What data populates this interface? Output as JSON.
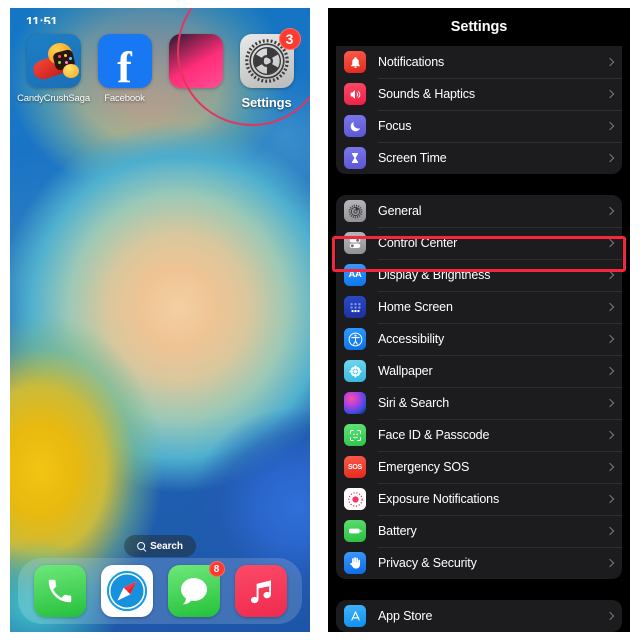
{
  "home": {
    "status_time": "11:51",
    "apps": [
      {
        "label": "CandyCrushSaga",
        "icon": "candy-crush-icon",
        "badge": null
      },
      {
        "label": "Facebook",
        "icon": "facebook-icon",
        "badge": null
      },
      {
        "label": "",
        "icon": "partially-hidden-app-icon",
        "badge": null
      },
      {
        "label": "Settings",
        "icon": "settings-gear-icon",
        "badge": "3"
      }
    ],
    "search": {
      "label": "Search",
      "icon": "search-icon"
    },
    "dock": [
      {
        "label": "Phone",
        "icon": "phone-icon",
        "badge": null
      },
      {
        "label": "Safari",
        "icon": "safari-compass-icon",
        "badge": null
      },
      {
        "label": "Messages",
        "icon": "messages-bubble-icon",
        "badge": "8"
      },
      {
        "label": "Music",
        "icon": "music-note-icon",
        "badge": null
      }
    ],
    "annotation": {
      "shape": "circle",
      "color": "#e0365f",
      "target": "Settings"
    }
  },
  "settings": {
    "title": "Settings",
    "highlight": {
      "target": "Control Center",
      "color": "#f8253f"
    },
    "groups": [
      {
        "name": "notifications-group",
        "rows": [
          {
            "label": "Notifications",
            "icon": "bell-icon",
            "icon_class": "ri-notif",
            "glyph": "▲"
          },
          {
            "label": "Sounds & Haptics",
            "icon": "speaker-icon",
            "icon_class": "ri-sounds",
            "glyph": "◀"
          },
          {
            "label": "Focus",
            "icon": "moon-icon",
            "icon_class": "ri-focus",
            "glyph": "☾"
          },
          {
            "label": "Screen Time",
            "icon": "hourglass-icon",
            "icon_class": "ri-screen",
            "glyph": "⧗"
          }
        ]
      },
      {
        "name": "general-group",
        "rows": [
          {
            "label": "General",
            "icon": "gear-icon",
            "icon_class": "ri-general",
            "glyph": "⚙"
          },
          {
            "label": "Control Center",
            "icon": "toggles-icon",
            "icon_class": "ri-control",
            "glyph": "⚇"
          },
          {
            "label": "Display & Brightness",
            "icon": "aa-text-size-icon",
            "icon_class": "ri-display",
            "glyph": "AA"
          },
          {
            "label": "Home Screen",
            "icon": "app-grid-icon",
            "icon_class": "ri-home",
            "glyph": "∷"
          },
          {
            "label": "Accessibility",
            "icon": "accessibility-icon",
            "icon_class": "ri-access",
            "glyph": "Ⓔ"
          },
          {
            "label": "Wallpaper",
            "icon": "wallpaper-flower-icon",
            "icon_class": "ri-wall",
            "glyph": "❀"
          },
          {
            "label": "Siri & Search",
            "icon": "siri-orb-icon",
            "icon_class": "ri-siri",
            "glyph": ""
          },
          {
            "label": "Face ID & Passcode",
            "icon": "face-id-icon",
            "icon_class": "ri-faceid",
            "glyph": "☺"
          },
          {
            "label": "Emergency SOS",
            "icon": "sos-icon",
            "icon_class": "ri-sos",
            "glyph": "SOS"
          },
          {
            "label": "Exposure Notifications",
            "icon": "exposure-dot-icon",
            "icon_class": "ri-expo",
            "glyph": "●"
          },
          {
            "label": "Battery",
            "icon": "battery-icon",
            "icon_class": "ri-battery",
            "glyph": "▬"
          },
          {
            "label": "Privacy & Security",
            "icon": "hand-privacy-icon",
            "icon_class": "ri-privacy",
            "glyph": "✋"
          }
        ]
      },
      {
        "name": "app-store-group",
        "rows": [
          {
            "label": "App Store",
            "icon": "app-store-icon",
            "icon_class": "ri-appstore",
            "glyph": "A"
          }
        ]
      }
    ]
  }
}
